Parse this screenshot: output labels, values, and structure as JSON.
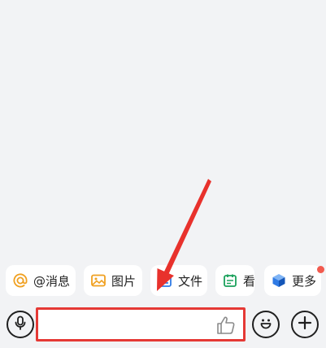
{
  "chips": {
    "at": {
      "label": "@消息",
      "icon": "at-icon",
      "color": "#f0a020"
    },
    "image": {
      "label": "图片",
      "icon": "image-icon",
      "color": "#f0a020"
    },
    "file": {
      "label": "文件",
      "icon": "file-icon",
      "color": "#2f7be5"
    },
    "watch": {
      "label": "看",
      "icon": "calendar-icon",
      "color": "#1aa15b"
    },
    "more": {
      "label": "更多",
      "icon": "cube-icon",
      "color": "#2f7be5"
    }
  },
  "input_bar": {
    "placeholder": "",
    "value": ""
  },
  "colors": {
    "highlight_border": "#e53935",
    "notification_dot": "#f25a4e",
    "background": "#f2f3f5"
  }
}
